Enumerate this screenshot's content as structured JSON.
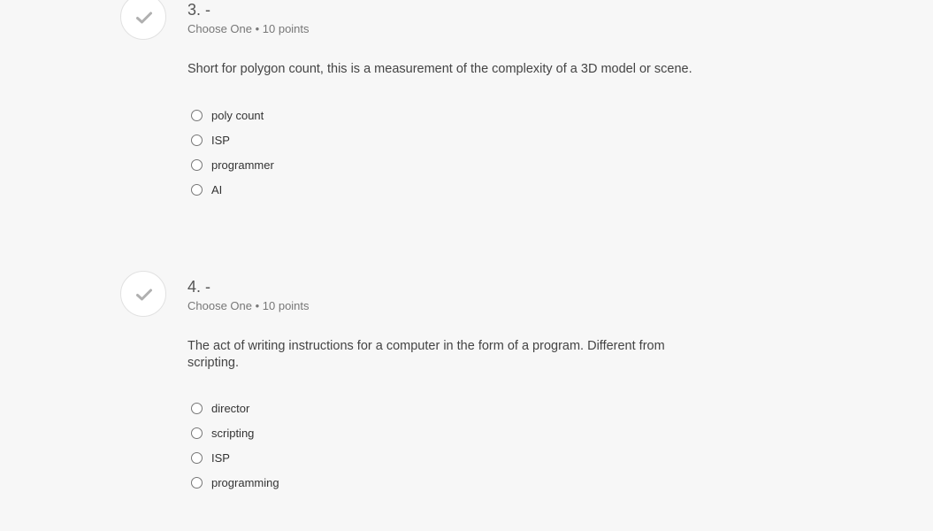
{
  "questions": [
    {
      "number": "3. -",
      "meta": "Choose One • 10 points",
      "text": "Short for polygon count, this is a measurement of the complexity of a 3D model or scene.",
      "options": [
        "poly count",
        "ISP",
        "programmer",
        "AI"
      ]
    },
    {
      "number": "4. -",
      "meta": "Choose One • 10 points",
      "text": "The act of writing instructions for a computer in the form of a program. Different from scripting.",
      "options": [
        "director",
        "scripting",
        "ISP",
        "programming"
      ]
    }
  ],
  "icons": {
    "status": "checkmark-icon",
    "option": "radio-icon"
  },
  "colors": {
    "background": "#f7f7f7",
    "check": "#b0b0b0"
  }
}
